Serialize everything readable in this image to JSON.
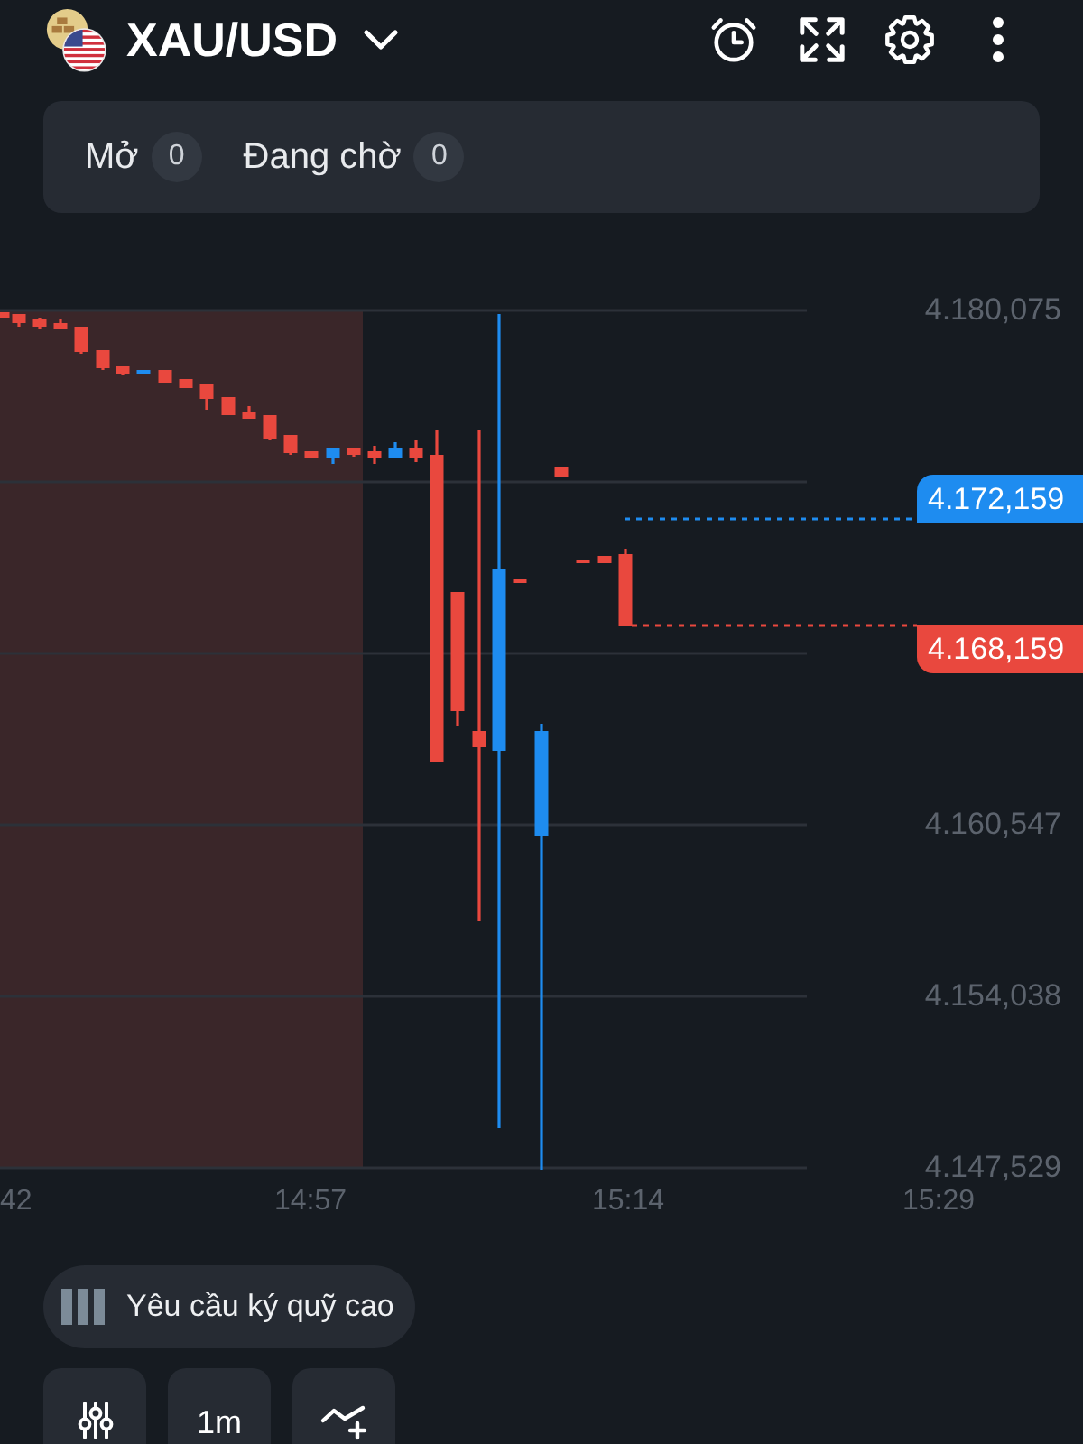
{
  "header": {
    "symbol": "XAU/USD"
  },
  "order_tabs": [
    {
      "label": "Mở",
      "count": "0"
    },
    {
      "label": "Đang chờ",
      "count": "0"
    }
  ],
  "chart": {
    "price_axis": [
      "4.180,075",
      "4.160,547",
      "4.154,038",
      "4.147,529"
    ],
    "time_axis": [
      "42",
      "14:57",
      "15:14",
      "15:29"
    ],
    "price_tags": [
      {
        "kind": "ask",
        "value": "4.172,159"
      },
      {
        "kind": "bid",
        "value": "4.168,159"
      }
    ]
  },
  "margin_notice": "Yêu cầu ký quỹ cao",
  "toolbar": {
    "timeframe": "1m"
  }
}
